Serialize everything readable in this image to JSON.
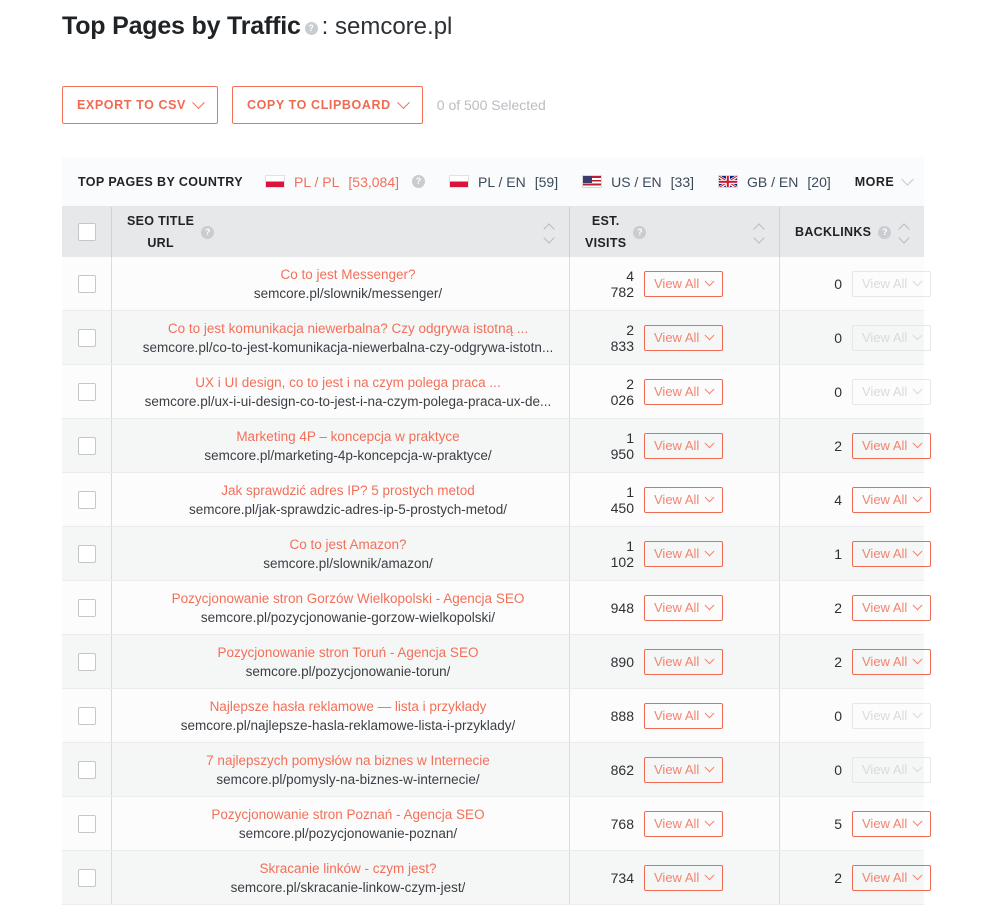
{
  "header": {
    "title_main": "Top Pages by Traffic",
    "help_glyph": "?",
    "title_sub": ": semcore.pl"
  },
  "toolbar": {
    "export_csv_label": "EXPORT TO CSV",
    "copy_clipboard_label": "COPY TO CLIPBOARD",
    "selected_text": "0 of 500 Selected"
  },
  "country_bar": {
    "label": "TOP PAGES BY COUNTRY",
    "more_label": "MORE",
    "items": [
      {
        "flag": "pl",
        "code": "PL / PL",
        "count": "[53,084]",
        "active": true,
        "has_help": true
      },
      {
        "flag": "pl",
        "code": "PL / EN",
        "count": "[59]",
        "active": false,
        "has_help": false
      },
      {
        "flag": "us",
        "code": "US / EN",
        "count": "[33]",
        "active": false,
        "has_help": false
      },
      {
        "flag": "gb",
        "code": "GB / EN",
        "count": "[20]",
        "active": false,
        "has_help": false
      }
    ]
  },
  "table": {
    "columns": {
      "seo_title_line1": "SEO TITLE",
      "seo_title_line2": "URL",
      "visits_line1": "EST.",
      "visits_line2": "VISITS",
      "backlinks": "BACKLINKS"
    },
    "view_all_label": "View All",
    "rows": [
      {
        "title": "Co to jest Messenger?",
        "url": "semcore.pl/slownik/messenger/",
        "visits": "4\n782",
        "backlinks": "0",
        "backlinks_active": false
      },
      {
        "title": "Co to jest komunikacja niewerbalna? Czy odgrywa istotną ...",
        "url": "semcore.pl/co-to-jest-komunikacja-niewerbalna-czy-odgrywa-istotn...",
        "visits": "2\n833",
        "backlinks": "0",
        "backlinks_active": false
      },
      {
        "title": "UX i UI design, co to jest i na czym polega praca ...",
        "url": "semcore.pl/ux-i-ui-design-co-to-jest-i-na-czym-polega-praca-ux-de...",
        "visits": "2\n026",
        "backlinks": "0",
        "backlinks_active": false
      },
      {
        "title": "Marketing 4P – koncepcja w praktyce",
        "url": "semcore.pl/marketing-4p-koncepcja-w-praktyce/",
        "visits": "1\n950",
        "backlinks": "2",
        "backlinks_active": true
      },
      {
        "title": "Jak sprawdzić adres IP? 5 prostych metod",
        "url": "semcore.pl/jak-sprawdzic-adres-ip-5-prostych-metod/",
        "visits": "1\n450",
        "backlinks": "4",
        "backlinks_active": true
      },
      {
        "title": "Co to jest Amazon?",
        "url": "semcore.pl/slownik/amazon/",
        "visits": "1\n102",
        "backlinks": "1",
        "backlinks_active": true
      },
      {
        "title": "Pozycjonowanie stron Gorzów Wielkopolski - Agencja SEO",
        "url": "semcore.pl/pozycjonowanie-gorzow-wielkopolski/",
        "visits": "948",
        "backlinks": "2",
        "backlinks_active": true
      },
      {
        "title": "Pozycjonowanie stron Toruń - Agencja SEO",
        "url": "semcore.pl/pozycjonowanie-torun/",
        "visits": "890",
        "backlinks": "2",
        "backlinks_active": true
      },
      {
        "title": "Najlepsze hasła reklamowe — lista i przykłady",
        "url": "semcore.pl/najlepsze-hasla-reklamowe-lista-i-przyklady/",
        "visits": "888",
        "backlinks": "0",
        "backlinks_active": false
      },
      {
        "title": "7 najlepszych pomysłów na biznes w Internecie",
        "url": "semcore.pl/pomysly-na-biznes-w-internecie/",
        "visits": "862",
        "backlinks": "0",
        "backlinks_active": false
      },
      {
        "title": "Pozycjonowanie stron Poznań - Agencja SEO",
        "url": "semcore.pl/pozycjonowanie-poznan/",
        "visits": "768",
        "backlinks": "5",
        "backlinks_active": true
      },
      {
        "title": "Skracanie linków - czym jest?",
        "url": "semcore.pl/skracanie-linkow-czym-jest/",
        "visits": "734",
        "backlinks": "2",
        "backlinks_active": true
      }
    ]
  },
  "colors": {
    "accent": "#f2705a",
    "accent_border": "#ef6a52",
    "text_dark": "#1f2326",
    "url_text": "#3a3f44",
    "header_bg": "#e6e8ea",
    "row_odd": "#fcfcfc",
    "row_even": "#f5f6f6",
    "muted": "#b9bdc2"
  }
}
